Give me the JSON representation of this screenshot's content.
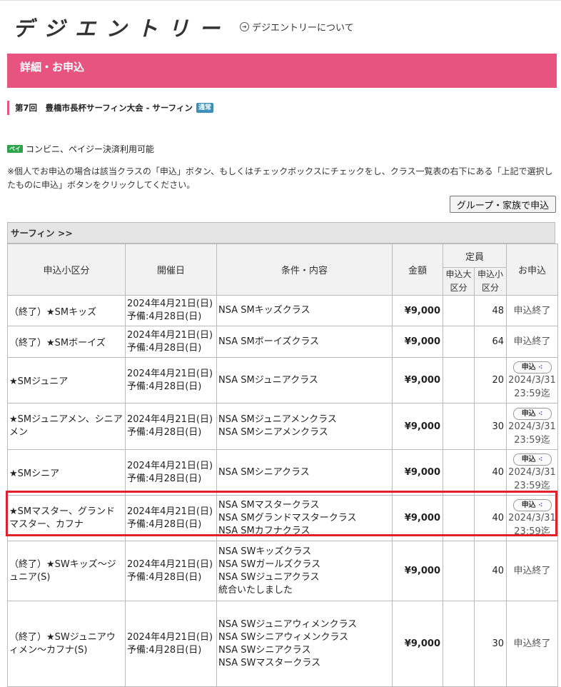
{
  "header": {
    "logo_text": "デジエントリー",
    "about_link": "デジエントリーについて"
  },
  "band_title": "詳細・お申込",
  "event": {
    "title": "第7回　豊橋市長杯サーフィン大会 - サーフィン",
    "tag": "通常"
  },
  "payment": {
    "icon_label": "ペイ",
    "text": "コンビニ、ペイジー決済利用可能"
  },
  "note": "※個人でお申込の場合は該当クラスの「申込」ボタン、もしくはチェックボックスにチェックをし、クラス一覧表の右下にある「上記で選択したものに申込」ボタンをクリックしてください。",
  "group_button": "グループ・家族で申込",
  "section_label": "サーフィン >>",
  "table": {
    "headers": {
      "category": "申込小区分",
      "date": "開催日",
      "conditions": "条件・内容",
      "price": "金額",
      "capacity": "定員",
      "cap_large": "申込大区分",
      "cap_small": "申込小区分",
      "apply": "お申込"
    },
    "rows": [
      {
        "category": "（終了）★SMキッズ",
        "date": "2024年4月21日(日)",
        "backup": "予備:4月28日(日)",
        "conditions": [
          "NSA SMキッズクラス"
        ],
        "price": "¥9,000",
        "cap_large": "",
        "cap_small": "48",
        "status": "申込終了",
        "apply_label": "",
        "deadline_date": "",
        "deadline_time": ""
      },
      {
        "category": "（終了）★SMボーイズ",
        "date": "2024年4月21日(日)",
        "backup": "予備:4月28日(日)",
        "conditions": [
          "NSA SMボーイズクラス"
        ],
        "price": "¥9,000",
        "cap_large": "",
        "cap_small": "64",
        "status": "申込終了",
        "apply_label": "",
        "deadline_date": "",
        "deadline_time": ""
      },
      {
        "category": "★SMジュニア",
        "date": "2024年4月21日(日)",
        "backup": "予備:4月28日(日)",
        "conditions": [
          "NSA SMジュニアクラス"
        ],
        "price": "¥9,000",
        "cap_large": "",
        "cap_small": "20",
        "status": "",
        "apply_label": "申込",
        "deadline_date": "2024/3/31",
        "deadline_time": "23:59迄"
      },
      {
        "category": "★SMジュニアメン、シニアメン",
        "date": "2024年4月21日(日)",
        "backup": "予備:4月28日(日)",
        "conditions": [
          "NSA SMジュニアメンクラス",
          "NSA SMシニアメンクラス"
        ],
        "price": "¥9,000",
        "cap_large": "",
        "cap_small": "30",
        "status": "",
        "apply_label": "申込",
        "deadline_date": "2024/3/31",
        "deadline_time": "23:59迄"
      },
      {
        "category": "★SMシニア",
        "date": "2024年4月21日(日)",
        "backup": "予備:4月28日(日)",
        "conditions": [
          "NSA SMシニアクラス"
        ],
        "price": "¥9,000",
        "cap_large": "",
        "cap_small": "40",
        "status": "",
        "apply_label": "申込",
        "deadline_date": "2024/3/31",
        "deadline_time": "23:59迄"
      },
      {
        "category": "★SMマスター、グランドマスター、カフナ",
        "date": "2024年4月21日(日)",
        "backup": "予備:4月28日(日)",
        "conditions": [
          "NSA SMマスタークラス",
          "NSA SMグランドマスタークラス",
          "NSA SMカフナクラス"
        ],
        "price": "¥9,000",
        "cap_large": "",
        "cap_small": "40",
        "status": "",
        "apply_label": "申込",
        "deadline_date": "2024/3/31",
        "deadline_time": "23:59迄"
      },
      {
        "category": "（終了）★SWキッズ～ジュニア(S)",
        "date": "2024年4月21日(日)",
        "backup": "予備:4月28日(日)",
        "conditions": [
          "NSA SWキッズクラス",
          "NSA SWガールズクラス",
          "NSA SWジュニアクラス",
          "統合いたしました"
        ],
        "price": "¥9,000",
        "cap_large": "",
        "cap_small": "40",
        "status": "申込終了",
        "apply_label": "",
        "deadline_date": "",
        "deadline_time": ""
      },
      {
        "category": "（終了）★SWジュニアウィメン～カフナ(S)",
        "date": "2024年4月21日(日)",
        "backup": "予備:4月28日(日)",
        "conditions": [
          "NSA SWジュニアウィメンクラス",
          "NSA SWシニアウィメンクラス",
          "NSA SWシニアクラス",
          "NSA SWマスタークラス"
        ],
        "price": "¥9,000",
        "cap_large": "",
        "cap_small": "30",
        "status": "申込終了",
        "apply_label": "",
        "deadline_date": "",
        "deadline_time": ""
      }
    ]
  }
}
